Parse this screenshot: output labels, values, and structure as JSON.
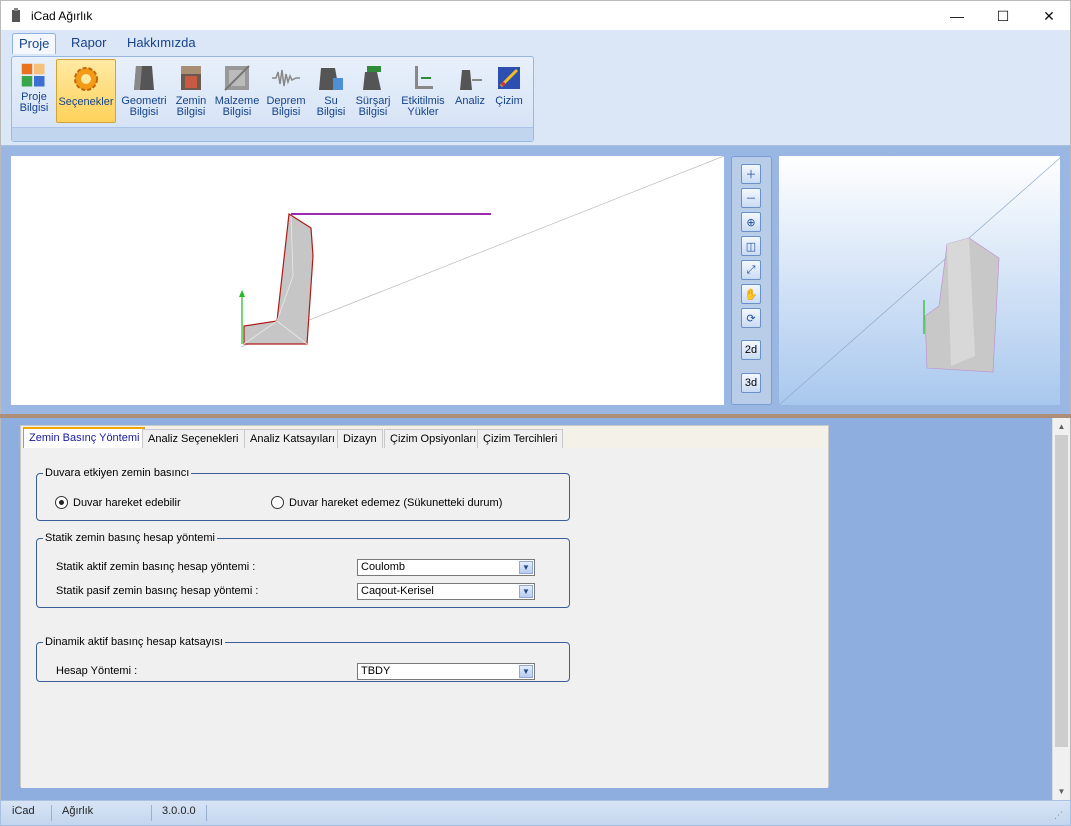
{
  "window": {
    "title": "iCad Ağırlık",
    "minimize_glyph": "—",
    "maximize_glyph": "☐",
    "close_glyph": "✕"
  },
  "ribbon": {
    "tabs": [
      {
        "label": "Proje"
      },
      {
        "label": "Rapor"
      },
      {
        "label": "Hakkımızda"
      }
    ],
    "buttons": [
      {
        "label": "Proje\nBilgisi",
        "icon": "project-info-icon"
      },
      {
        "label": "Seçenekler",
        "icon": "gear-icon"
      },
      {
        "label": "Geometri\nBilgisi",
        "icon": "geometry-icon"
      },
      {
        "label": "Zemin\nBilgisi",
        "icon": "soil-icon"
      },
      {
        "label": "Malzeme\nBilgisi",
        "icon": "material-icon"
      },
      {
        "label": "Deprem\nBilgisi",
        "icon": "seismic-icon"
      },
      {
        "label": "Su\nBilgisi",
        "icon": "water-icon"
      },
      {
        "label": "Sürşarj\nBilgisi",
        "icon": "surcharge-icon"
      },
      {
        "label": "Etkitilmis\nYükler",
        "icon": "loads-icon"
      },
      {
        "label": "Analiz",
        "icon": "analysis-icon"
      },
      {
        "label": "Çizim",
        "icon": "drawing-icon"
      }
    ]
  },
  "view_tools": {
    "buttons": [
      "zoom-in-icon",
      "zoom-out-icon",
      "zoom-window-icon",
      "zoom-selection-icon",
      "zoom-extents-icon",
      "pan-hand-icon",
      "refresh-icon"
    ],
    "label_2d": "2d",
    "label_3d": "3d"
  },
  "tabs": [
    {
      "label": "Zemin Basınç Yöntemi"
    },
    {
      "label": "Analiz Seçenekleri"
    },
    {
      "label": "Analiz Katsayıları"
    },
    {
      "label": "Dizayn"
    },
    {
      "label": "Çizim Opsiyonları"
    },
    {
      "label": "Çizim Tercihleri"
    }
  ],
  "group1": {
    "legend": "Duvara etkiyen zemin basıncı",
    "option_a": "Duvar hareket edebilir",
    "option_b": "Duvar hareket edemez (Sükunetteki durum)"
  },
  "group2": {
    "legend": "Statik zemin basınç hesap yöntemi",
    "active_label": "Statik aktif zemin basınç hesap yöntemi :",
    "active_value": "Coulomb",
    "passive_label": "Statik pasif zemin basınç hesap yöntemi :",
    "passive_value": "Caqout-Kerisel"
  },
  "group3": {
    "legend": "Dinamik aktif basınç hesap katsayısı",
    "method_label": "Hesap Yöntemi :",
    "method_value": "TBDY"
  },
  "status": {
    "app": "iCad",
    "module": "Ağırlık",
    "version": "3.0.0.0"
  },
  "colors": {
    "ribbon_bg": "#dbe6f6",
    "view_bg": "#9ab7e3",
    "lower_bg": "#8eaedf",
    "accent_tab": "#f0a600",
    "wall_outline": "#b01a1a",
    "surcharge_line": "#9b2ab0"
  }
}
